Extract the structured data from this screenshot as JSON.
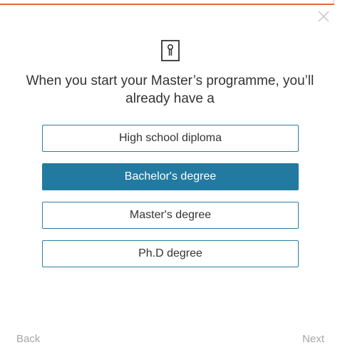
{
  "dialog": {
    "close_icon": "close-icon",
    "header_icon": "diploma-icon",
    "accent_color": "#e8643f",
    "question": "When you start your Master’s programme, you’ll already have a"
  },
  "options": [
    {
      "label": "High school diploma",
      "selected": false
    },
    {
      "label": "Bachelor's degree",
      "selected": true
    },
    {
      "label": "Master's degree",
      "selected": false
    },
    {
      "label": "Ph.D degree",
      "selected": false
    }
  ],
  "selected_color": "#237aa0",
  "footer": {
    "back_label": "Back",
    "next_label": "Next"
  }
}
